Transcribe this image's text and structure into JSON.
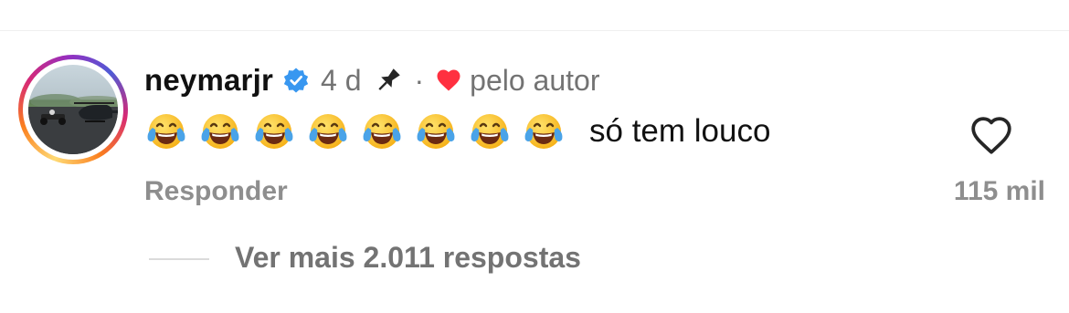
{
  "comment": {
    "username": "neymarjr",
    "time": "4 d",
    "separator": "·",
    "liked_by_author_label": "pelo autor",
    "emojis": [
      "😂",
      "😂",
      "😂",
      "😂",
      "😂",
      "😂",
      "😂",
      "😂"
    ],
    "text": "só tem louco",
    "reply_label": "Responder",
    "likes_count": "115 mil",
    "view_replies_label": "Ver mais 2.011 respostas"
  },
  "icons": {
    "verified": "verified-badge-icon",
    "pin": "pin-icon",
    "author_heart": "heart-filled-icon",
    "like": "heart-outline-icon",
    "emoji": "face-with-tears-of-joy"
  },
  "colors": {
    "verified": "#3897f0",
    "author_heart": "#ff3040",
    "secondary_text": "#737373",
    "primary_text": "#111111"
  }
}
